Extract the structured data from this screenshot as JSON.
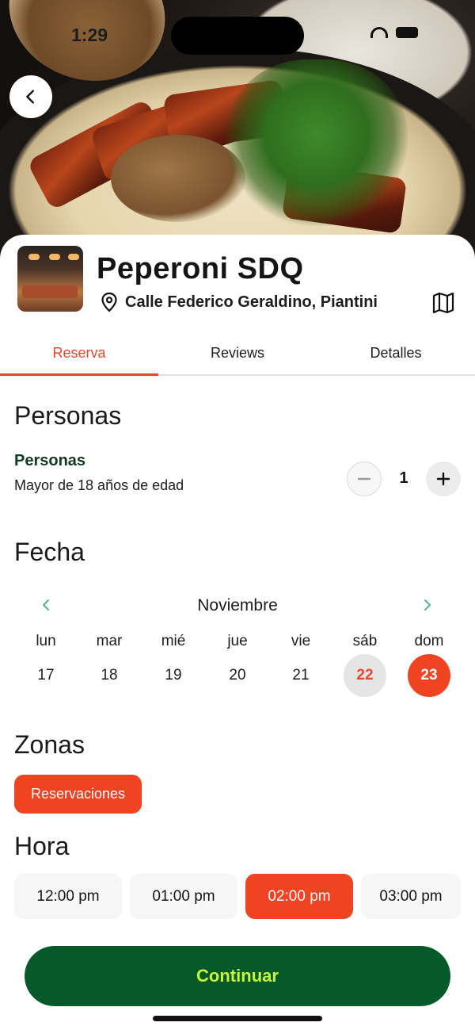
{
  "status_bar": {
    "time": "1:29"
  },
  "restaurant": {
    "name": "Peperoni SDQ",
    "address": "Calle Federico Geraldino, Piantini"
  },
  "tabs": [
    {
      "label": "Reserva",
      "active": true
    },
    {
      "label": "Reviews",
      "active": false
    },
    {
      "label": "Detalles",
      "active": false
    }
  ],
  "people": {
    "section_title": "Personas",
    "label": "Personas",
    "subtitle": "Mayor de 18 años de edad",
    "count": "1"
  },
  "date": {
    "section_title": "Fecha",
    "month": "Noviembre",
    "weekdays": [
      "lun",
      "mar",
      "mié",
      "jue",
      "vie",
      "sáb",
      "dom"
    ],
    "days": [
      "17",
      "18",
      "19",
      "20",
      "21",
      "22",
      "23"
    ],
    "selected_day": "23"
  },
  "zones": {
    "section_title": "Zonas",
    "options": [
      "Reservaciones"
    ],
    "selected": "Reservaciones"
  },
  "time": {
    "section_title": "Hora",
    "options": [
      "12:00 pm",
      "01:00 pm",
      "02:00 pm",
      "03:00 pm"
    ],
    "selected": "02:00 pm"
  },
  "continue_label": "Continuar",
  "colors": {
    "accent": "#ef4322",
    "primary_button": "#065a2a",
    "primary_button_text": "#c6f53a",
    "persona_label": "#0e3a26",
    "chevron": "#4fb59a"
  },
  "icons": [
    "back-arrow-icon",
    "location-pin-icon",
    "map-icon",
    "minus-icon",
    "plus-icon",
    "chevron-left-icon",
    "chevron-right-icon"
  ]
}
